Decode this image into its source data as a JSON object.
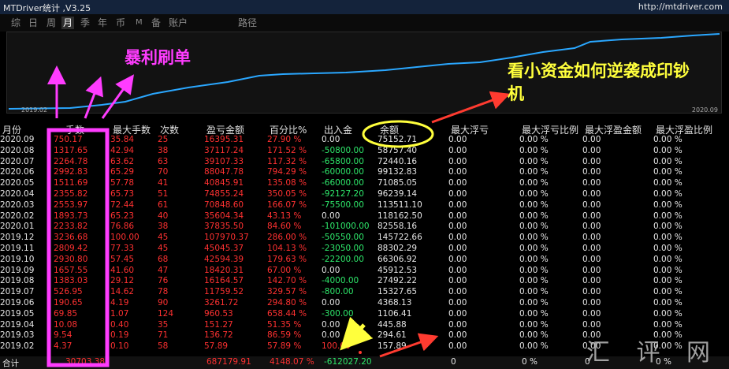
{
  "window": {
    "title": "MTDriver统计 ,V3.25",
    "url": "http://mtdriver.com"
  },
  "tabs": [
    "综",
    "日",
    "周",
    "月",
    "季",
    "年",
    "币",
    "M",
    "备",
    "账户",
    "路径"
  ],
  "active_tab": "月",
  "chart": {
    "x_start": "2019.02",
    "x_end": "2020.09"
  },
  "columns": [
    "月份",
    "手数",
    "最大手数",
    "次数",
    "盈亏金额",
    "百分比%",
    "出入金",
    "余额",
    "最大浮亏",
    "最大浮亏比例",
    "最大浮盈金额",
    "最大浮盈比例"
  ],
  "rows": [
    [
      "2020.09",
      "750.17",
      "35.84",
      "25",
      "16395.31",
      "27.90 %",
      "0.00",
      "75152.71",
      "0.00",
      "0.00 %",
      "0.00",
      "0.00 %"
    ],
    [
      "2020.08",
      "1317.65",
      "42.94",
      "38",
      "37117.24",
      "171.52 %",
      "-50800.00",
      "58757.40",
      "0.00",
      "0.00 %",
      "0.00",
      "0.00 %"
    ],
    [
      "2020.07",
      "2264.78",
      "63.62",
      "63",
      "39107.33",
      "117.32 %",
      "-65800.00",
      "72440.16",
      "0.00",
      "0.00 %",
      "0.00",
      "0.00 %"
    ],
    [
      "2020.06",
      "2992.83",
      "65.29",
      "70",
      "88047.78",
      "794.29 %",
      "-60000.00",
      "99132.83",
      "0.00",
      "0.00 %",
      "0.00",
      "0.00 %"
    ],
    [
      "2020.05",
      "1511.69",
      "57.78",
      "41",
      "40845.91",
      "135.08 %",
      "-66000.00",
      "71085.05",
      "0.00",
      "0.00 %",
      "0.00",
      "0.00 %"
    ],
    [
      "2020.04",
      "2355.82",
      "65.73",
      "51",
      "74855.24",
      "350.05 %",
      "-92127.20",
      "96239.14",
      "0.00",
      "0.00 %",
      "0.00",
      "0.00 %"
    ],
    [
      "2020.03",
      "2553.97",
      "72.44",
      "61",
      "70848.60",
      "166.07 %",
      "-75500.00",
      "113511.10",
      "0.00",
      "0.00 %",
      "0.00",
      "0.00 %"
    ],
    [
      "2020.02",
      "1893.73",
      "65.23",
      "40",
      "35604.34",
      "43.13 %",
      "0.00",
      "118162.50",
      "0.00",
      "0.00 %",
      "0.00",
      "0.00 %"
    ],
    [
      "2020.01",
      "2233.82",
      "76.86",
      "38",
      "37835.50",
      "84.60 %",
      "-101000.00",
      "82558.16",
      "0.00",
      "0.00 %",
      "0.00",
      "0.00 %"
    ],
    [
      "2019.12",
      "3236.68",
      "100.00",
      "45",
      "107970.37",
      "286.00 %",
      "-50550.00",
      "145722.66",
      "0.00",
      "0.00 %",
      "0.00",
      "0.00 %"
    ],
    [
      "2019.11",
      "2809.42",
      "77.33",
      "45",
      "45045.37",
      "104.13 %",
      "-23050.00",
      "88302.29",
      "0.00",
      "0.00 %",
      "0.00",
      "0.00 %"
    ],
    [
      "2019.10",
      "2930.80",
      "57.45",
      "68",
      "42594.39",
      "179.63 %",
      "-22200.00",
      "66306.92",
      "0.00",
      "0.00 %",
      "0.00",
      "0.00 %"
    ],
    [
      "2019.09",
      "1657.55",
      "41.60",
      "47",
      "18420.31",
      "67.00 %",
      "0.00",
      "45912.53",
      "0.00",
      "0.00 %",
      "0.00",
      "0.00 %"
    ],
    [
      "2019.08",
      "1383.03",
      "29.12",
      "76",
      "16164.57",
      "142.70 %",
      "-4000.00",
      "27492.22",
      "0.00",
      "0.00 %",
      "0.00",
      "0.00 %"
    ],
    [
      "2019.07",
      "526.95",
      "14.62",
      "78",
      "11759.52",
      "329.57 %",
      "-800.00",
      "15327.65",
      "0.00",
      "0.00 %",
      "0.00",
      "0.00 %"
    ],
    [
      "2019.06",
      "190.65",
      "4.19",
      "90",
      "3261.72",
      "294.80 %",
      "0.00",
      "4368.13",
      "0.00",
      "0.00 %",
      "0.00",
      "0.00 %"
    ],
    [
      "2019.05",
      "69.85",
      "1.07",
      "124",
      "960.53",
      "658.44 %",
      "-300.00",
      "1106.41",
      "0.00",
      "0.00 %",
      "0.00",
      "0.00 %"
    ],
    [
      "2019.04",
      "10.08",
      "0.40",
      "35",
      "151.27",
      "51.35 %",
      "0.00",
      "445.88",
      "0.00",
      "0.00 %",
      "0.00",
      "0.00 %"
    ],
    [
      "2019.03",
      "9.54",
      "0.19",
      "71",
      "136.72",
      "86.59 %",
      "0.00",
      "294.61",
      "0.00",
      "0.00 %",
      "0.00",
      "0.00 %"
    ],
    [
      "2019.02",
      "4.37",
      "0.10",
      "58",
      "57.89",
      "57.89 %",
      "100.00",
      "157.89",
      "0.00",
      "0.00 %",
      "0.00",
      "0.00 %"
    ]
  ],
  "total": {
    "label": "合计",
    "lots": "30703.38",
    "profit": "687179.91",
    "pct": "4148.07 %",
    "flow": "-612027.20",
    "c8": "0",
    "c9": "0 %",
    "c10": "0",
    "c11": "0 %"
  },
  "annotations": {
    "a1": "暴利刷单",
    "a2": "看小资金如何逆袭成印钞",
    "a3": "机"
  },
  "watermark": "汇 评 网",
  "colors": {
    "accent": "#ff3cff",
    "callout_yellow": "#ffff3c",
    "curve": "#2aa7ff"
  }
}
